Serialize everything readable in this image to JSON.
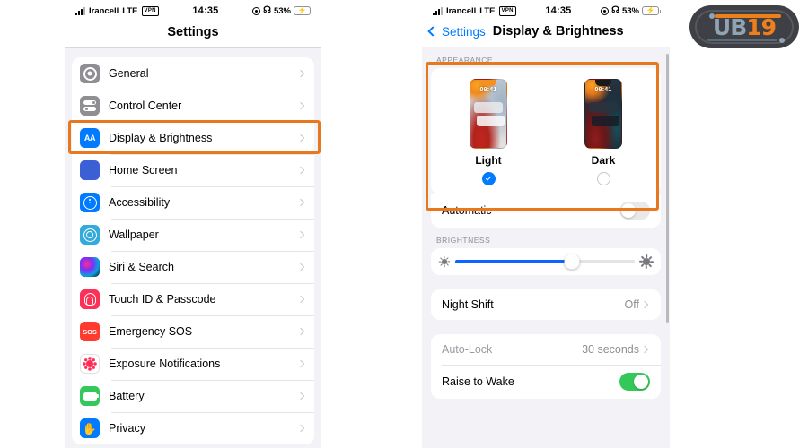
{
  "status_bar": {
    "carrier": "Irancell",
    "network": "LTE",
    "vpn_badge": "VPN",
    "time": "14:35",
    "battery_percent": "53%",
    "location_icon": "location-arrow-icon",
    "headphones_icon": "headphones-icon",
    "battery_icon": "battery-charging-icon",
    "signal_icon": "cellular-signal-icon"
  },
  "left_phone": {
    "nav_title": "Settings",
    "highlight_color": "#e8781e",
    "items": [
      {
        "label": "General",
        "icon": "general-gear-icon",
        "chevron": "chevron-right-icon"
      },
      {
        "label": "Control Center",
        "icon": "control-center-icon",
        "chevron": "chevron-right-icon"
      },
      {
        "label": "Display & Brightness",
        "icon": "display-brightness-icon",
        "icon_text": "AA",
        "chevron": "chevron-right-icon",
        "highlighted": true
      },
      {
        "label": "Home Screen",
        "icon": "home-screen-icon",
        "chevron": "chevron-right-icon"
      },
      {
        "label": "Accessibility",
        "icon": "accessibility-icon",
        "chevron": "chevron-right-icon"
      },
      {
        "label": "Wallpaper",
        "icon": "wallpaper-icon",
        "chevron": "chevron-right-icon"
      },
      {
        "label": "Siri & Search",
        "icon": "siri-icon",
        "chevron": "chevron-right-icon"
      },
      {
        "label": "Touch ID & Passcode",
        "icon": "touch-id-fingerprint-icon",
        "chevron": "chevron-right-icon"
      },
      {
        "label": "Emergency SOS",
        "icon": "emergency-sos-icon",
        "icon_text": "SOS",
        "chevron": "chevron-right-icon"
      },
      {
        "label": "Exposure Notifications",
        "icon": "exposure-notifications-icon",
        "chevron": "chevron-right-icon"
      },
      {
        "label": "Battery",
        "icon": "battery-icon",
        "chevron": "chevron-right-icon"
      },
      {
        "label": "Privacy",
        "icon": "privacy-hand-icon",
        "chevron": "chevron-right-icon"
      }
    ]
  },
  "right_phone": {
    "back_label": "Settings",
    "nav_title": "Display & Brightness",
    "appearance": {
      "section_header": "APPEARANCE",
      "options": [
        {
          "label": "Light",
          "thumb_time": "09:41",
          "selected": true,
          "radio": "radio-checked-icon"
        },
        {
          "label": "Dark",
          "thumb_time": "09:41",
          "selected": false,
          "radio": "radio-unchecked-icon"
        }
      ],
      "automatic_label": "Automatic",
      "automatic_on": false
    },
    "brightness": {
      "section_header": "BRIGHTNESS",
      "value_percent": 65,
      "low_icon": "sun-small-icon",
      "high_icon": "sun-large-icon"
    },
    "night_shift": {
      "label": "Night Shift",
      "value": "Off",
      "chevron": "chevron-right-icon"
    },
    "lock_group": [
      {
        "label": "Auto-Lock",
        "value": "30 seconds",
        "type": "disclosure",
        "dimmed": true,
        "chevron": "chevron-right-icon"
      },
      {
        "label": "Raise to Wake",
        "value": "",
        "type": "toggle",
        "dimmed": false,
        "toggle_on": true
      }
    ]
  },
  "logo": {
    "part_one": "UB",
    "part_two": "19",
    "color_text": "#8fa3b3",
    "color_accent": "#ef7f1a",
    "background": "#3e4045"
  }
}
